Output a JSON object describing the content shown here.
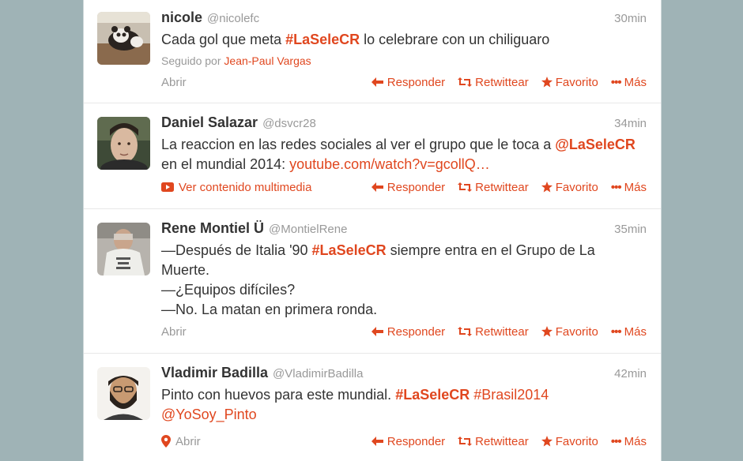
{
  "tweets": [
    {
      "fullname": "nicole",
      "username": "@nicolefc",
      "time": "30min",
      "text_pre": "Cada gol que meta ",
      "hashtag": "#LaSeleCR",
      "text_post": " lo celebrare con un chiliguaro",
      "context_label": "Seguido por ",
      "context_user": "Jean-Paul Vargas",
      "expand_label": "Abrir"
    },
    {
      "fullname": "Daniel Salazar",
      "username": "@dsvcr28",
      "time": "34min",
      "text_pre": "La reaccion en las redes sociales al ver el grupo que le toca a ",
      "mention": "@LaSeleCR",
      "text_mid": " en el mundial 2014: ",
      "link": "youtube.com/watch?v=gcollQ…",
      "expand_label": "Ver contenido multimedia"
    },
    {
      "fullname": "Rene Montiel Ü",
      "username": "@MontielRene",
      "time": "35min",
      "line1_pre": "—Después de Italia '90 ",
      "hashtag": "#LaSeleCR",
      "line1_post": " siempre entra en el Grupo de La Muerte.",
      "line2": "—¿Equipos difíciles?",
      "line3": "—No. La matan en primera ronda.",
      "expand_label": "Abrir"
    },
    {
      "fullname": "Vladimir Badilla",
      "username": "@VladimirBadilla",
      "time": "42min",
      "text_pre": "Pinto con huevos para este mundial. ",
      "hashtag1": "#LaSeleCR",
      "hashtag2": "#Brasil2014",
      "mention": "@YoSoy_Pinto",
      "expand_label": "Abrir"
    }
  ],
  "actions": {
    "reply": "Responder",
    "retweet": "Retwittear",
    "favorite": "Favorito",
    "more": "Más"
  },
  "icons": {
    "reply": "reply-arrow-icon",
    "retweet": "retweet-icon",
    "favorite": "star-icon",
    "more": "more-dots-icon",
    "media": "video-play-icon",
    "location": "location-pin-icon"
  },
  "colors": {
    "accent": "#e0471f",
    "background": "#9fb3b6",
    "muted": "#999999",
    "text": "#333333"
  }
}
